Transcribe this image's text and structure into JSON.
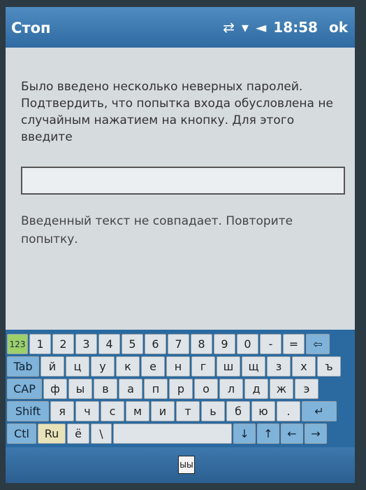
{
  "window": {
    "title": "Стоп",
    "time": "18:58",
    "ok_label": "ok"
  },
  "status_icons": [
    "connectivity-icon",
    "signal-icon",
    "volume-icon"
  ],
  "message": "Было введено несколько неверных паролей. Подтвердить, что попытка входа обусловлена не случайным нажатием на кнопку. Для этого введите",
  "input": {
    "value": ""
  },
  "error": "Введенный текст не совпадает. Повторите попытку.",
  "keyboard": {
    "row1": [
      "123",
      "1",
      "2",
      "3",
      "4",
      "5",
      "6",
      "7",
      "8",
      "9",
      "0",
      "-",
      "=",
      "⇦"
    ],
    "row2": [
      "Tab",
      "й",
      "ц",
      "у",
      "к",
      "е",
      "н",
      "г",
      "ш",
      "щ",
      "з",
      "х",
      "ъ"
    ],
    "row3": [
      "CAP",
      "ф",
      "ы",
      "в",
      "а",
      "п",
      "р",
      "о",
      "л",
      "д",
      "ж",
      "э"
    ],
    "row4": [
      "Shift",
      "я",
      "ч",
      "с",
      "м",
      "и",
      "т",
      "ь",
      "б",
      "ю",
      ".",
      "↵"
    ],
    "row5": [
      "Ctl",
      "Ru",
      "ё",
      "\\",
      "",
      "↓",
      "↑",
      "←",
      "→"
    ]
  },
  "bottom": {
    "sip_label": "ЫЫ"
  },
  "colors": {
    "titlebar": "#2f6aa2",
    "keyboard_bg": "#2a6aa0",
    "key": "#dfe4e8",
    "key_green": "#9cd06a"
  }
}
